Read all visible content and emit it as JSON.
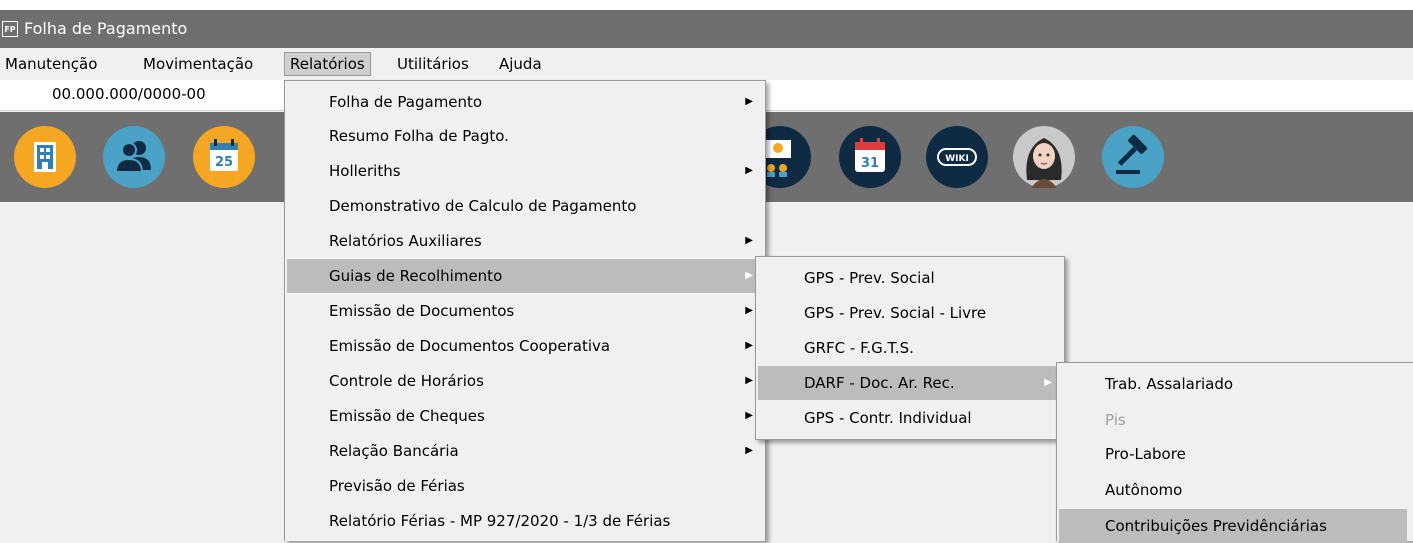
{
  "window": {
    "app_icon": "FP",
    "title": "Folha de Pagamento"
  },
  "menubar": {
    "items": [
      {
        "label": "Manutenção"
      },
      {
        "label": "Movimentação"
      },
      {
        "label": "Relatórios"
      },
      {
        "label": "Utilitários"
      },
      {
        "label": "Ajuda"
      }
    ]
  },
  "company": {
    "cnpj": "00.000.000/0000-00"
  },
  "toolbar": {
    "icons": [
      "building-icon",
      "users-icon",
      "calendar-25-icon",
      "employees-icon",
      "calendar-31-icon",
      "wiki-icon",
      "assistant-avatar-icon",
      "gavel-icon"
    ],
    "calendar_day_1": "25",
    "calendar_day_2": "31",
    "wiki_label": "WIKI"
  },
  "relatorios_menu": {
    "items": [
      {
        "label": "Folha de Pagamento",
        "submenu": true
      },
      {
        "label": "Resumo Folha de Pagto.",
        "submenu": false
      },
      {
        "label": "Holleriths",
        "submenu": true
      },
      {
        "label": "Demonstrativo de Calculo de Pagamento",
        "submenu": false
      },
      {
        "label": "Relatórios Auxiliares",
        "submenu": true
      },
      {
        "label": "Guias de Recolhimento",
        "submenu": true,
        "highlighted": true
      },
      {
        "label": "Emissão de Documentos",
        "submenu": true
      },
      {
        "label": "Emissão de Documentos Cooperativa",
        "submenu": true
      },
      {
        "label": "Controle de Horários",
        "submenu": true
      },
      {
        "label": "Emissão de Cheques",
        "submenu": true
      },
      {
        "label": "Relação Bancária",
        "submenu": true
      },
      {
        "label": "Previsão de Férias",
        "submenu": false
      },
      {
        "label": "Relatório Férias - MP 927/2020 - 1/3 de Férias",
        "submenu": false
      }
    ]
  },
  "guias_menu": {
    "items": [
      {
        "label": "GPS - Prev. Social"
      },
      {
        "label": "GPS - Prev. Social - Livre"
      },
      {
        "label": "GRFC - F.G.T.S."
      },
      {
        "label": "DARF - Doc. Ar. Rec.",
        "submenu": true,
        "highlighted": true
      },
      {
        "label": "GPS - Contr. Individual"
      }
    ]
  },
  "darf_menu": {
    "items": [
      {
        "label": "Trab. Assalariado"
      },
      {
        "label": "Pis",
        "disabled": true
      },
      {
        "label": "Pro-Labore"
      },
      {
        "label": "Autônomo"
      },
      {
        "label": "Contribuições Previdênciárias",
        "hover": true
      }
    ]
  },
  "colors": {
    "toolbar_bg": "#6f6f6f",
    "icon_orange": "#f5a623",
    "icon_teal": "#4aa3c6",
    "icon_dark": "#0f2a43",
    "highlight": "#bcbcbc"
  }
}
